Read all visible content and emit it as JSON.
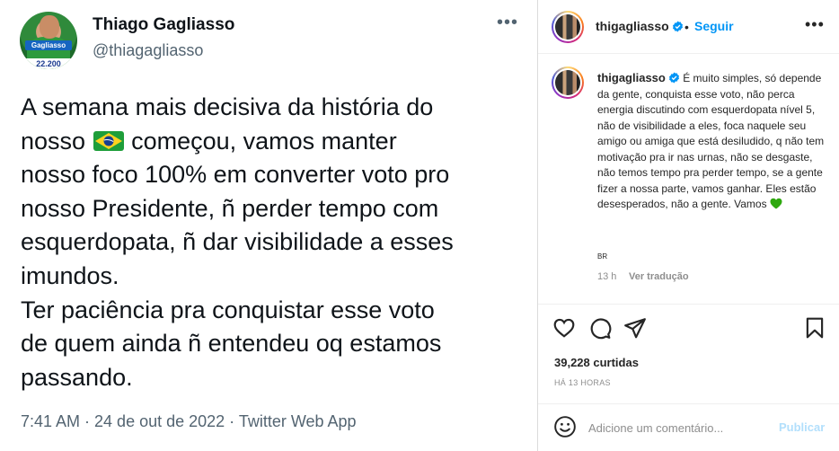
{
  "tweet": {
    "name": "Thiago Gagliasso",
    "handle": "@thiagagliasso",
    "avatar_badge_name": "Gagliasso",
    "avatar_badge_number": "22.200",
    "text_before_flag": "A semana mais decisiva da história do\nnosso ",
    "text_after_flag": " começou, vamos manter\nnosso foco 100% em converter voto pro\nnosso Presidente, ñ perder tempo com\nesquerdopata, ñ dar visibilidade a esses\nimundos.\nTer paciência pra conquistar esse voto\nde quem ainda ñ entendeu oq estamos\npassando.",
    "flag_icon": "brazil-flag-icon",
    "meta": "7:41 AM · 24 de out de 2022 · Twitter Web App",
    "more_icon": "…"
  },
  "instagram": {
    "header_username": "thigagliasso",
    "follow_separator": "•",
    "follow_label": "Seguir",
    "more_icon": "…",
    "caption_username": "thigagliasso",
    "caption_text": " É muito simples, só depende da gente, conquista esse voto, não perca energia discutindo com esquerdopata nível 5, não de visibilidade a eles, foca naquele seu amigo ou amiga que está desiludido, q não tem motivação pra ir nas urnas, não se desgaste, não temos tempo pra perder tempo, se a gente fizer a nossa parte, vamos ganhar. Eles estão desesperados, não a gente. Vamos ",
    "caption_emoji": "green-heart-icon",
    "country_code": "BR",
    "caption_time": "13 h",
    "translate_label": "Ver tradução",
    "likes": "39,228 curtidas",
    "posted_ago": "HÁ 13 HORAS",
    "comment_placeholder": "Adicione um comentário...",
    "post_label": "Publicar",
    "colors": {
      "follow": "#0095f6",
      "verified": "#0095f6",
      "post_disabled": "#b2dffc",
      "heart": "#2ea80f"
    }
  }
}
